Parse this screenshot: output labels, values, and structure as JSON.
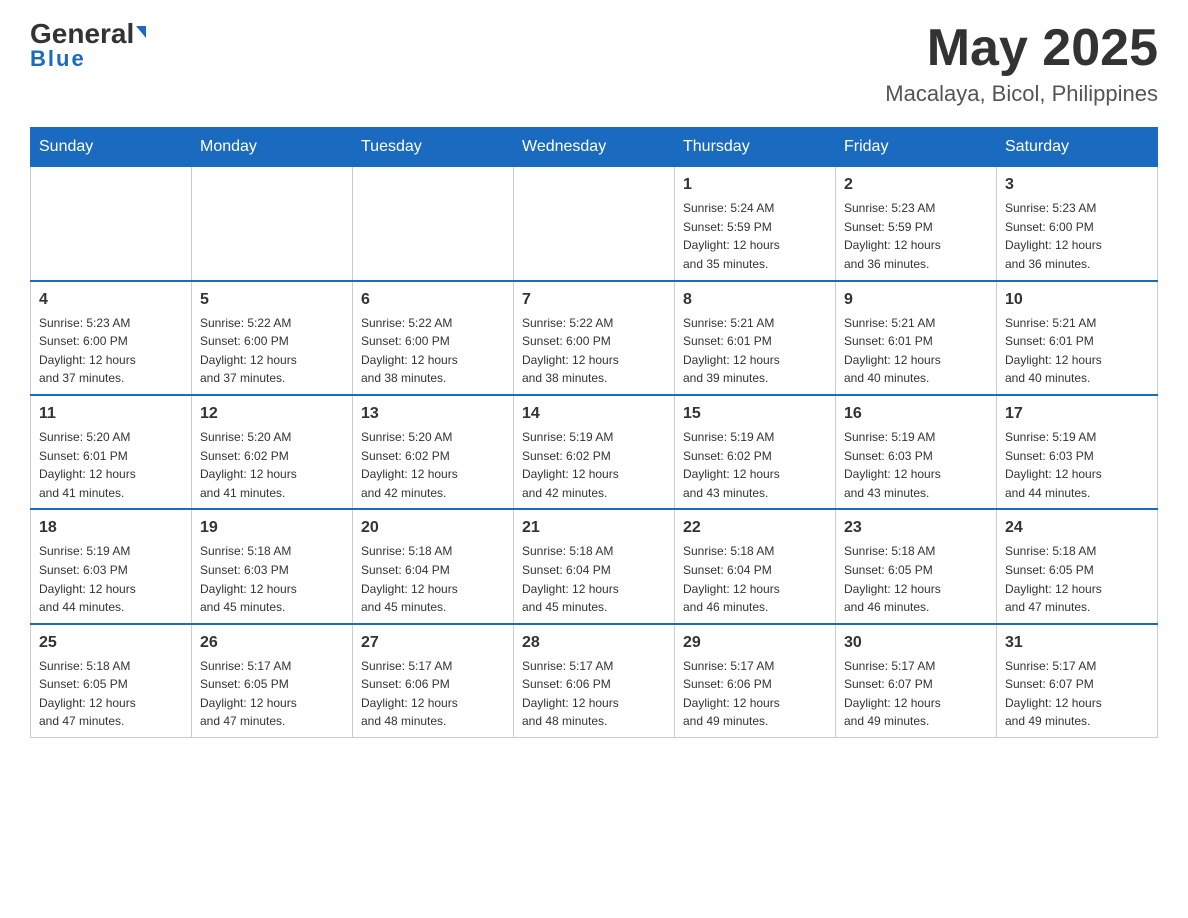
{
  "header": {
    "logo_general": "General",
    "logo_blue": "Blue",
    "month": "May 2025",
    "location": "Macalaya, Bicol, Philippines"
  },
  "weekdays": [
    "Sunday",
    "Monday",
    "Tuesday",
    "Wednesday",
    "Thursday",
    "Friday",
    "Saturday"
  ],
  "weeks": [
    [
      {
        "day": "",
        "info": ""
      },
      {
        "day": "",
        "info": ""
      },
      {
        "day": "",
        "info": ""
      },
      {
        "day": "",
        "info": ""
      },
      {
        "day": "1",
        "info": "Sunrise: 5:24 AM\nSunset: 5:59 PM\nDaylight: 12 hours\nand 35 minutes."
      },
      {
        "day": "2",
        "info": "Sunrise: 5:23 AM\nSunset: 5:59 PM\nDaylight: 12 hours\nand 36 minutes."
      },
      {
        "day": "3",
        "info": "Sunrise: 5:23 AM\nSunset: 6:00 PM\nDaylight: 12 hours\nand 36 minutes."
      }
    ],
    [
      {
        "day": "4",
        "info": "Sunrise: 5:23 AM\nSunset: 6:00 PM\nDaylight: 12 hours\nand 37 minutes."
      },
      {
        "day": "5",
        "info": "Sunrise: 5:22 AM\nSunset: 6:00 PM\nDaylight: 12 hours\nand 37 minutes."
      },
      {
        "day": "6",
        "info": "Sunrise: 5:22 AM\nSunset: 6:00 PM\nDaylight: 12 hours\nand 38 minutes."
      },
      {
        "day": "7",
        "info": "Sunrise: 5:22 AM\nSunset: 6:00 PM\nDaylight: 12 hours\nand 38 minutes."
      },
      {
        "day": "8",
        "info": "Sunrise: 5:21 AM\nSunset: 6:01 PM\nDaylight: 12 hours\nand 39 minutes."
      },
      {
        "day": "9",
        "info": "Sunrise: 5:21 AM\nSunset: 6:01 PM\nDaylight: 12 hours\nand 40 minutes."
      },
      {
        "day": "10",
        "info": "Sunrise: 5:21 AM\nSunset: 6:01 PM\nDaylight: 12 hours\nand 40 minutes."
      }
    ],
    [
      {
        "day": "11",
        "info": "Sunrise: 5:20 AM\nSunset: 6:01 PM\nDaylight: 12 hours\nand 41 minutes."
      },
      {
        "day": "12",
        "info": "Sunrise: 5:20 AM\nSunset: 6:02 PM\nDaylight: 12 hours\nand 41 minutes."
      },
      {
        "day": "13",
        "info": "Sunrise: 5:20 AM\nSunset: 6:02 PM\nDaylight: 12 hours\nand 42 minutes."
      },
      {
        "day": "14",
        "info": "Sunrise: 5:19 AM\nSunset: 6:02 PM\nDaylight: 12 hours\nand 42 minutes."
      },
      {
        "day": "15",
        "info": "Sunrise: 5:19 AM\nSunset: 6:02 PM\nDaylight: 12 hours\nand 43 minutes."
      },
      {
        "day": "16",
        "info": "Sunrise: 5:19 AM\nSunset: 6:03 PM\nDaylight: 12 hours\nand 43 minutes."
      },
      {
        "day": "17",
        "info": "Sunrise: 5:19 AM\nSunset: 6:03 PM\nDaylight: 12 hours\nand 44 minutes."
      }
    ],
    [
      {
        "day": "18",
        "info": "Sunrise: 5:19 AM\nSunset: 6:03 PM\nDaylight: 12 hours\nand 44 minutes."
      },
      {
        "day": "19",
        "info": "Sunrise: 5:18 AM\nSunset: 6:03 PM\nDaylight: 12 hours\nand 45 minutes."
      },
      {
        "day": "20",
        "info": "Sunrise: 5:18 AM\nSunset: 6:04 PM\nDaylight: 12 hours\nand 45 minutes."
      },
      {
        "day": "21",
        "info": "Sunrise: 5:18 AM\nSunset: 6:04 PM\nDaylight: 12 hours\nand 45 minutes."
      },
      {
        "day": "22",
        "info": "Sunrise: 5:18 AM\nSunset: 6:04 PM\nDaylight: 12 hours\nand 46 minutes."
      },
      {
        "day": "23",
        "info": "Sunrise: 5:18 AM\nSunset: 6:05 PM\nDaylight: 12 hours\nand 46 minutes."
      },
      {
        "day": "24",
        "info": "Sunrise: 5:18 AM\nSunset: 6:05 PM\nDaylight: 12 hours\nand 47 minutes."
      }
    ],
    [
      {
        "day": "25",
        "info": "Sunrise: 5:18 AM\nSunset: 6:05 PM\nDaylight: 12 hours\nand 47 minutes."
      },
      {
        "day": "26",
        "info": "Sunrise: 5:17 AM\nSunset: 6:05 PM\nDaylight: 12 hours\nand 47 minutes."
      },
      {
        "day": "27",
        "info": "Sunrise: 5:17 AM\nSunset: 6:06 PM\nDaylight: 12 hours\nand 48 minutes."
      },
      {
        "day": "28",
        "info": "Sunrise: 5:17 AM\nSunset: 6:06 PM\nDaylight: 12 hours\nand 48 minutes."
      },
      {
        "day": "29",
        "info": "Sunrise: 5:17 AM\nSunset: 6:06 PM\nDaylight: 12 hours\nand 49 minutes."
      },
      {
        "day": "30",
        "info": "Sunrise: 5:17 AM\nSunset: 6:07 PM\nDaylight: 12 hours\nand 49 minutes."
      },
      {
        "day": "31",
        "info": "Sunrise: 5:17 AM\nSunset: 6:07 PM\nDaylight: 12 hours\nand 49 minutes."
      }
    ]
  ]
}
